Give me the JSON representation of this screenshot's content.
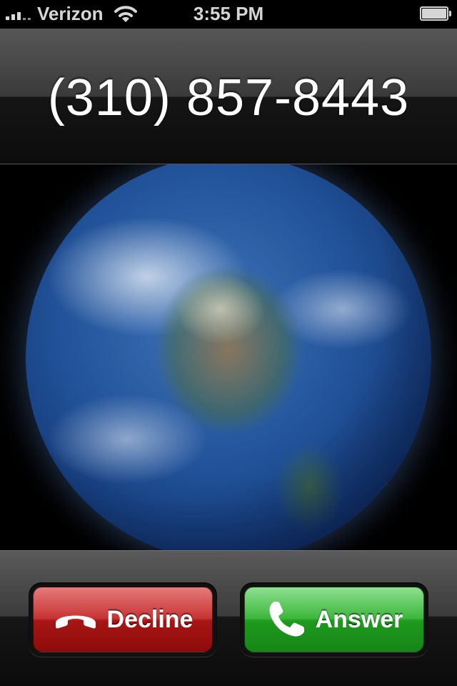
{
  "status_bar": {
    "carrier": "Verizon",
    "time": "3:55 PM",
    "signal_icon": "signal-bars-icon",
    "wifi_icon": "wifi-icon",
    "battery_icon": "battery-icon"
  },
  "caller": {
    "number": "(310) 857-8443"
  },
  "wallpaper": {
    "image": "earth-wallpaper"
  },
  "actions": {
    "decline_label": "Decline",
    "decline_icon": "phone-hangup-icon",
    "decline_color": "#b01c1c",
    "answer_label": "Answer",
    "answer_icon": "phone-answer-icon",
    "answer_color": "#26a326"
  }
}
